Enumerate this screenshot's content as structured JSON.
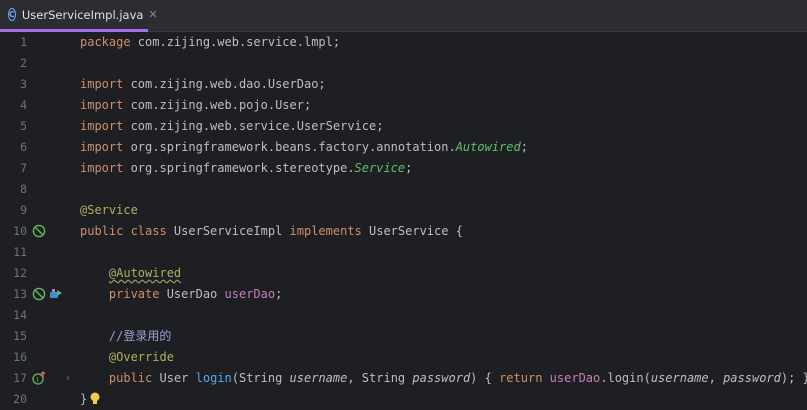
{
  "tab": {
    "icon": "class-c-icon",
    "label": "UserServiceImpl.java",
    "close": "✕"
  },
  "lines": [
    {
      "n": "1",
      "code": "package com.zijing.web.service.lmpl;"
    },
    {
      "n": "2",
      "code": ""
    },
    {
      "n": "3",
      "code": "import com.zijing.web.dao.UserDao;"
    },
    {
      "n": "4",
      "code": "import com.zijing.web.pojo.User;"
    },
    {
      "n": "5",
      "code": "import com.zijing.web.service.UserService;"
    },
    {
      "n": "6",
      "code": "import org.springframework.beans.factory.annotation.Autowired;"
    },
    {
      "n": "7",
      "code": "import org.springframework.stereotype.Service;"
    },
    {
      "n": "8",
      "code": ""
    },
    {
      "n": "9",
      "code": "@Service"
    },
    {
      "n": "10",
      "code": "public class UserServiceImpl implements UserService {"
    },
    {
      "n": "11",
      "code": ""
    },
    {
      "n": "12",
      "code": "    @Autowired"
    },
    {
      "n": "13",
      "code": "    private UserDao userDao;"
    },
    {
      "n": "14",
      "code": ""
    },
    {
      "n": "15",
      "code": "    //登录用的"
    },
    {
      "n": "16",
      "code": "    @Override"
    },
    {
      "n": "17",
      "code": "    public User login(String username, String password) { return userDao.login(username, password); }"
    },
    {
      "n": "20",
      "code": "}"
    }
  ],
  "gutter_icons": {
    "line10": [
      "spring-bean-icon"
    ],
    "line13": [
      "spring-bean-icon",
      "autowired-navigate-icon"
    ],
    "line17": [
      "implements-method-icon",
      "fold-expand-icon"
    ],
    "line20": [
      "intention-bulb-icon"
    ]
  },
  "colors": {
    "background": "#1e1f22",
    "tab_bar": "#2b2d30",
    "tab_underline": "#a571e6",
    "keyword": "#cf8e6d",
    "annotation": "#b3ae60",
    "field": "#c77dbb",
    "method": "#56a8f5",
    "comment": "#7a7e85",
    "text": "#bcbec4",
    "line_number": "#6f737a"
  }
}
